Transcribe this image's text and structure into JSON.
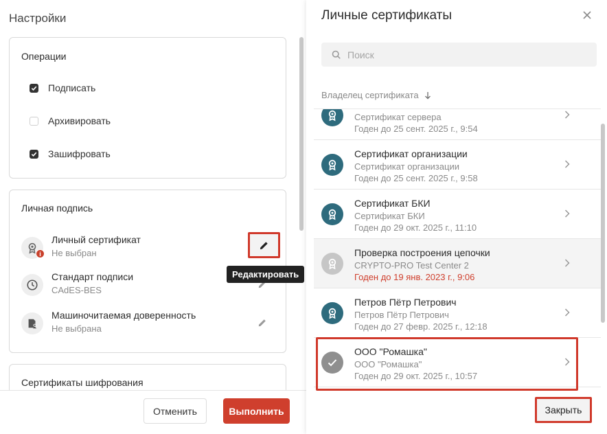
{
  "settings": {
    "title": "Настройки",
    "operations": {
      "title": "Операции",
      "items": [
        {
          "label": "Подписать",
          "checked": true
        },
        {
          "label": "Архивировать",
          "checked": false
        },
        {
          "label": "Зашифровать",
          "checked": true
        }
      ]
    },
    "signature": {
      "title": "Личная подпись",
      "rows": [
        {
          "name": "Личный сертификат",
          "value": "Не выбран",
          "icon": "certificate-icon",
          "warning": true
        },
        {
          "name": "Стандарт подписи",
          "value": "CAdES-BES",
          "icon": "clock-icon"
        },
        {
          "name": "Машиночитаемая доверенность",
          "value": "Не выбрана",
          "icon": "document-user-icon"
        }
      ],
      "tooltip": "Редактировать",
      "warning_icon": "i"
    },
    "encryption": {
      "title": "Сертификаты шифрования"
    },
    "footer": {
      "cancel": "Отменить",
      "submit": "Выполнить"
    }
  },
  "certs": {
    "title": "Личные сертификаты",
    "search_placeholder": "Поиск",
    "column_header": "Владелец сертификата",
    "sort": "descending",
    "items": [
      {
        "name": "",
        "type": "Сертификат сервера",
        "valid": "Годен до 25 сент. 2025 г., 9:54",
        "expired": false
      },
      {
        "name": "Сертификат организации",
        "type": "Сертификат организации",
        "valid": "Годен до 25 сент. 2025 г., 9:58",
        "expired": false
      },
      {
        "name": "Сертификат БКИ",
        "type": "Сертификат БКИ",
        "valid": "Годен до 29 окт. 2025 г., 11:10",
        "expired": false
      },
      {
        "name": "Проверка построения цепочки",
        "type": "CRYPTO-PRO Test Center 2",
        "valid": "Годен до 19 янв. 2023 г., 9:06",
        "expired": true
      },
      {
        "name": "Петров Пётр Петрович",
        "type": "Петров Пётр Петрович",
        "valid": "Годен до 27 февр. 2025 г., 12:18",
        "expired": false
      },
      {
        "name": "ООО \"Ромашка\"",
        "type": "ООО \"Ромашка\"",
        "valid": "Годен до 29 окт. 2025 г., 10:57",
        "expired": false,
        "selected": true
      }
    ],
    "close": "Закрыть"
  },
  "colors": {
    "accent": "#cf3f2d",
    "cert_teal": "#2e6b7d",
    "highlight": "#d0392b"
  }
}
